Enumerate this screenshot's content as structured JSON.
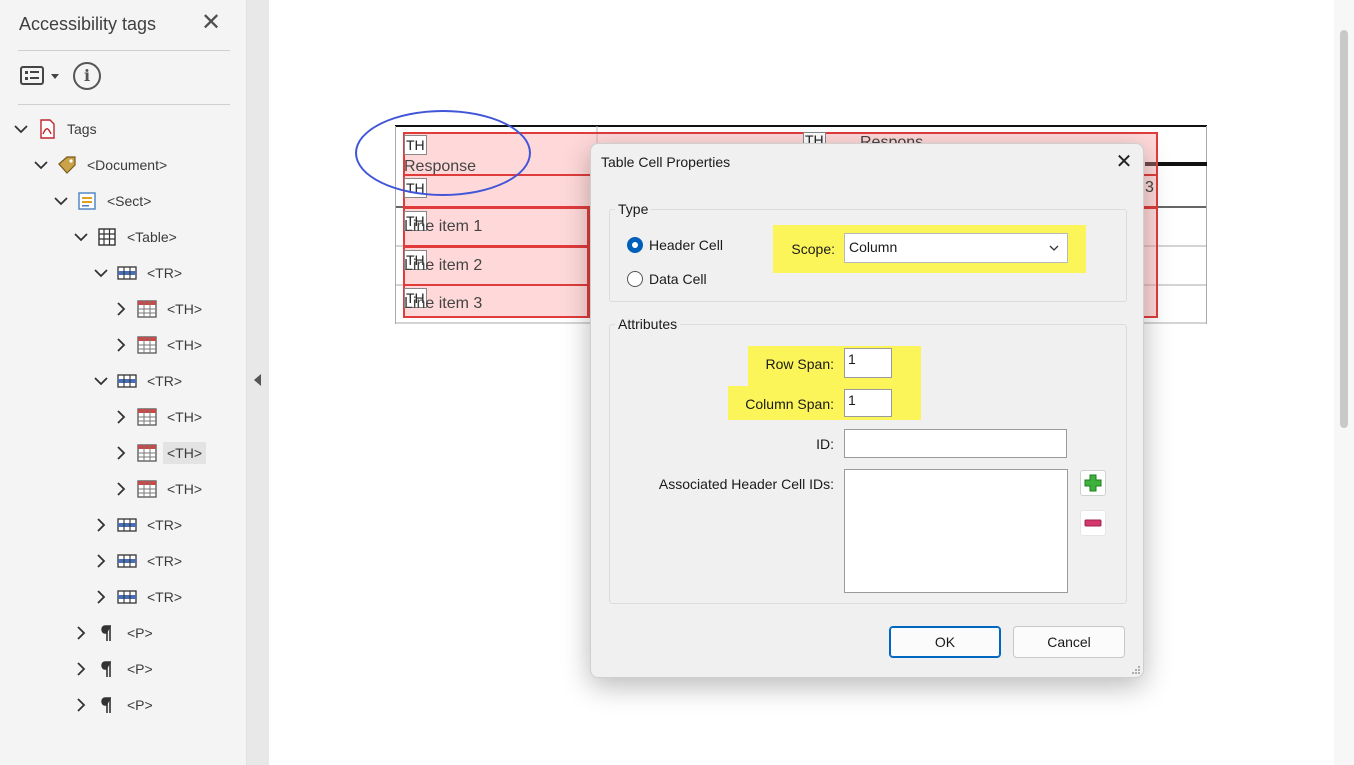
{
  "panel": {
    "title": "Accessibility tags",
    "tree": [
      {
        "label": "Tags",
        "icon": "pdf-icon"
      },
      {
        "label": "<Document>",
        "icon": "tag-icon"
      },
      {
        "label": "<Sect>",
        "icon": "section-icon"
      },
      {
        "label": "<Table>",
        "icon": "table-icon"
      },
      {
        "label": "<TR>",
        "icon": "table-row-icon"
      },
      {
        "label": "<TH>",
        "icon": "table-header-icon"
      },
      {
        "label": "<TH>",
        "icon": "table-header-icon"
      },
      {
        "label": "<TR>",
        "icon": "table-row-icon"
      },
      {
        "label": "<TH>",
        "icon": "table-header-icon"
      },
      {
        "label": "<TH>",
        "icon": "table-header-icon",
        "selected": true
      },
      {
        "label": "<TH>",
        "icon": "table-header-icon"
      },
      {
        "label": "<TR>",
        "icon": "table-row-icon"
      },
      {
        "label": "<TR>",
        "icon": "table-row-icon"
      },
      {
        "label": "<TR>",
        "icon": "table-row-icon"
      },
      {
        "label": "<P>",
        "icon": "paragraph-icon"
      },
      {
        "label": "<P>",
        "icon": "paragraph-icon"
      },
      {
        "label": "<P>",
        "icon": "paragraph-icon"
      }
    ]
  },
  "document": {
    "tags": {
      "th": "TH",
      "th_partial": "TH"
    },
    "cells": {
      "header1": "Response",
      "partial_header": "Respons",
      "row1": "Line item 1",
      "row2": "Line item 2",
      "row3": "Line item 3",
      "partial_col": "3"
    }
  },
  "dialog": {
    "title": "Table Cell Properties",
    "type_group": "Type",
    "header_cell": "Header Cell",
    "data_cell": "Data Cell",
    "scope_label": "Scope:",
    "scope_value": "Column",
    "attributes_group": "Attributes",
    "row_span_label": "Row Span:",
    "row_span_value": "1",
    "column_span_label": "Column Span:",
    "column_span_value": "1",
    "id_label": "ID:",
    "id_value": "",
    "associated_label": "Associated Header Cell IDs:",
    "ok": "OK",
    "cancel": "Cancel"
  },
  "colors": {
    "highlight": "#fcf55a",
    "cell_overlay": "#ffa0a0",
    "cell_border": "#e03c3c",
    "annotation_ellipse": "#4055d8",
    "primary_accent": "#0067c0"
  }
}
